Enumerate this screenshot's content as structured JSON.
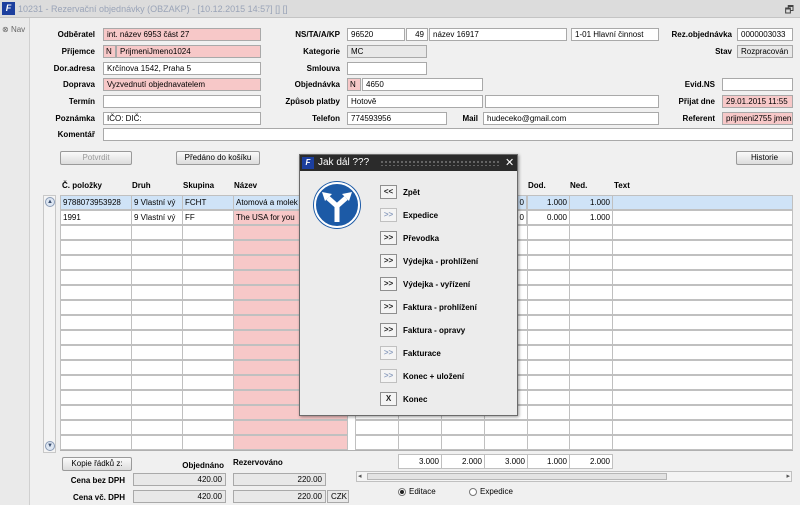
{
  "window": {
    "title": "10231 - Rezervační objednávky (OBZAKP) - [10.12.2015 14:57] [] []",
    "nav_label": "Nav"
  },
  "header": {
    "odberatel_label": "Odběratel",
    "odberatel_value": "int. název 6953 část 27",
    "prijemce_label": "Příjemce",
    "prijemce_flag": "N",
    "prijemce_value": "PrijmeniJmeno1024",
    "dor_adresa_label": "Dor.adresa",
    "dor_adresa_value": "Krčínova 1542, Praha 5",
    "doprava_label": "Doprava",
    "doprava_value": "Vyzvednutí objednavatelem",
    "termin_label": "Termín",
    "termin_value": "",
    "poznamka_label": "Poznámka",
    "poznamka_value": "IČO: DIČ:",
    "komentar_label": "Komentář",
    "komentar_value": "",
    "ns_label": "NS/TA/A/KP",
    "ns_value": "96520",
    "ta_value": "49",
    "a_value": "název 16917",
    "kp_value": "1-01 Hlavní činnost",
    "kategorie_label": "Kategorie",
    "kategorie_value": "MC",
    "smlouva_label": "Smlouva",
    "smlouva_value": "",
    "objednavka_label": "Objednávka",
    "objednavka_flag": "N",
    "objednavka_value": "4650",
    "zpusob_label": "Způsob platby",
    "zpusob_value": "Hotově",
    "telefon_label": "Telefon",
    "telefon_value": "774593956",
    "mail_label": "Mail",
    "mail_value": "hudeceko@gmail.com",
    "rez_label": "Rez.objednávka",
    "rez_value": "0000003033",
    "stav_label": "Stav",
    "stav_value": "Rozpracován",
    "evid_label": "Evid.NS",
    "evid_value": "",
    "prijat_label": "Přijat dne",
    "prijat_value": "29.01.2015 11:55",
    "referent_label": "Referent",
    "referent_value": "prijmeni2755 jmen"
  },
  "toolbar": {
    "potvrdit": "Potvrdit",
    "predano": "Předáno do košíku",
    "historie": "Historie"
  },
  "table": {
    "headers": [
      "Č. položky",
      "Druh",
      "Skupina",
      "Název",
      "Dod.",
      "Ned.",
      "Text"
    ],
    "rows": [
      {
        "cislo": "9788073953928",
        "druh": "9 Vlastní vý",
        "skupina": "FCHT",
        "nazev": "Atomová a molek",
        "c0": "0",
        "dod": "1.000",
        "ned": "1.000"
      },
      {
        "cislo": "1991",
        "druh": "9 Vlastní vý",
        "skupina": "FF",
        "nazev": "The USA for you",
        "c0": "0",
        "dod": "0.000",
        "ned": "1.000"
      }
    ],
    "totals": [
      "3.000",
      "2.000",
      "3.000",
      "1.000",
      "2.000"
    ]
  },
  "footer": {
    "kopie": "Kopie řádků z:",
    "objednano": "Objednáno",
    "rezervovano": "Rezervováno",
    "cena_bez_label": "Cena bez DPH",
    "cena_bez_obj": "420.00",
    "cena_bez_rez": "220.00",
    "cena_vc_label": "Cena vč. DPH",
    "cena_vc_obj": "420.00",
    "cena_vc_rez": "220.00",
    "mena": "CZK",
    "editace": "Editace",
    "expedice": "Expedice",
    "selected_mode": "Editace"
  },
  "dialog": {
    "title": "Jak dál ???",
    "close": "✕",
    "sign_icon": "road-fork-sign-icon",
    "items": [
      {
        "btn": "<<",
        "label": "Zpět"
      },
      {
        "btn": ">>",
        "label": "Expedice"
      },
      {
        "btn": ">>",
        "label": "Převodka"
      },
      {
        "btn": ">>",
        "label": "Výdejka - prohlížení"
      },
      {
        "btn": ">>",
        "label": "Výdejka - vyřízení"
      },
      {
        "btn": ">>",
        "label": "Faktura - prohlížení"
      },
      {
        "btn": ">>",
        "label": "Faktura - opravy"
      },
      {
        "btn": ">>",
        "label": "Fakturace"
      },
      {
        "btn": ">>",
        "label": "Konec + uložení"
      },
      {
        "btn": "X",
        "label": "Konec"
      }
    ]
  }
}
